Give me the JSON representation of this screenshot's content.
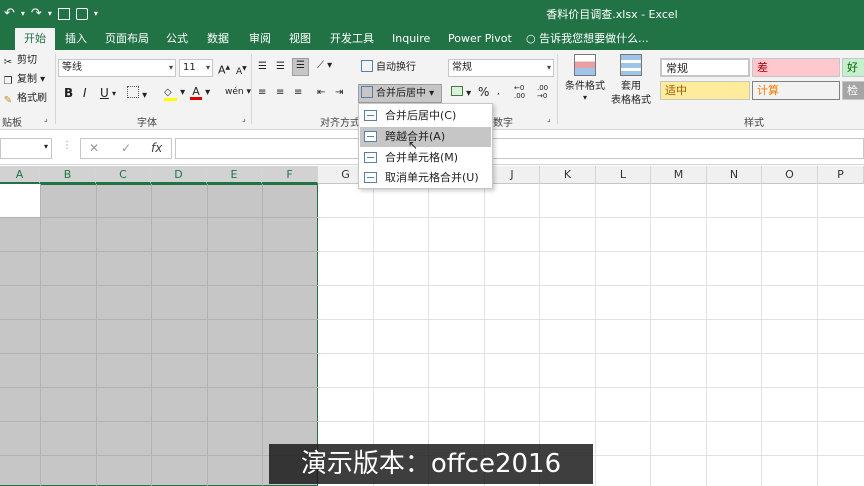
{
  "window": {
    "title": "香料价目调查.xlsx - Excel"
  },
  "qat": {
    "undo": "↶",
    "redo": "↷"
  },
  "tabs": [
    {
      "label": "开始"
    },
    {
      "label": "插入"
    },
    {
      "label": "页面布局"
    },
    {
      "label": "公式"
    },
    {
      "label": "数据"
    },
    {
      "label": "审阅"
    },
    {
      "label": "视图"
    },
    {
      "label": "开发工具"
    },
    {
      "label": "Inquire"
    },
    {
      "label": "Power Pivot"
    }
  ],
  "tell_me": "告诉我您想要做什么...",
  "clipboard": {
    "cut": "剪切",
    "copy": "复制",
    "format_painter": "格式刷",
    "group": "贴板"
  },
  "font": {
    "name": "等线",
    "size": "11",
    "bold": "B",
    "italic": "I",
    "underline": "U",
    "grow": "A",
    "shrink": "A",
    "wen": "wén",
    "group": "字体"
  },
  "alignment": {
    "wrap_text": "自动换行",
    "merge_center": "合并后居中",
    "group": "对齐方式"
  },
  "number": {
    "format": "常规",
    "percent": "%",
    "group": "数字"
  },
  "styles": {
    "conditional": "条件格式",
    "table_l1": "套用",
    "table_l2": "表格格式",
    "cells": [
      {
        "label": "常规"
      },
      {
        "label": "差"
      },
      {
        "label": "好"
      },
      {
        "label": "适中"
      },
      {
        "label": "计算"
      },
      {
        "label": "检"
      }
    ],
    "group": "样式"
  },
  "formula_bar": {
    "fx": "fx",
    "cancel": "✕",
    "enter": "✓"
  },
  "columns": [
    "A",
    "B",
    "C",
    "D",
    "E",
    "F",
    "G",
    "H",
    "I",
    "J",
    "K",
    "L",
    "M",
    "N",
    "O",
    "P"
  ],
  "merge_menu": [
    {
      "label": "合并后居中(C)"
    },
    {
      "label": "跨越合并(A)"
    },
    {
      "label": "合并单元格(M)"
    },
    {
      "label": "取消单元格合并(U)"
    }
  ],
  "caption": "演示版本：offce2016",
  "colors": {
    "accent": "#217346",
    "selection": "#c6c6c6",
    "bad_bg": "#ffc7ce",
    "neutral_bg": "#ffeb9c",
    "good_bg": "#c6efce"
  }
}
